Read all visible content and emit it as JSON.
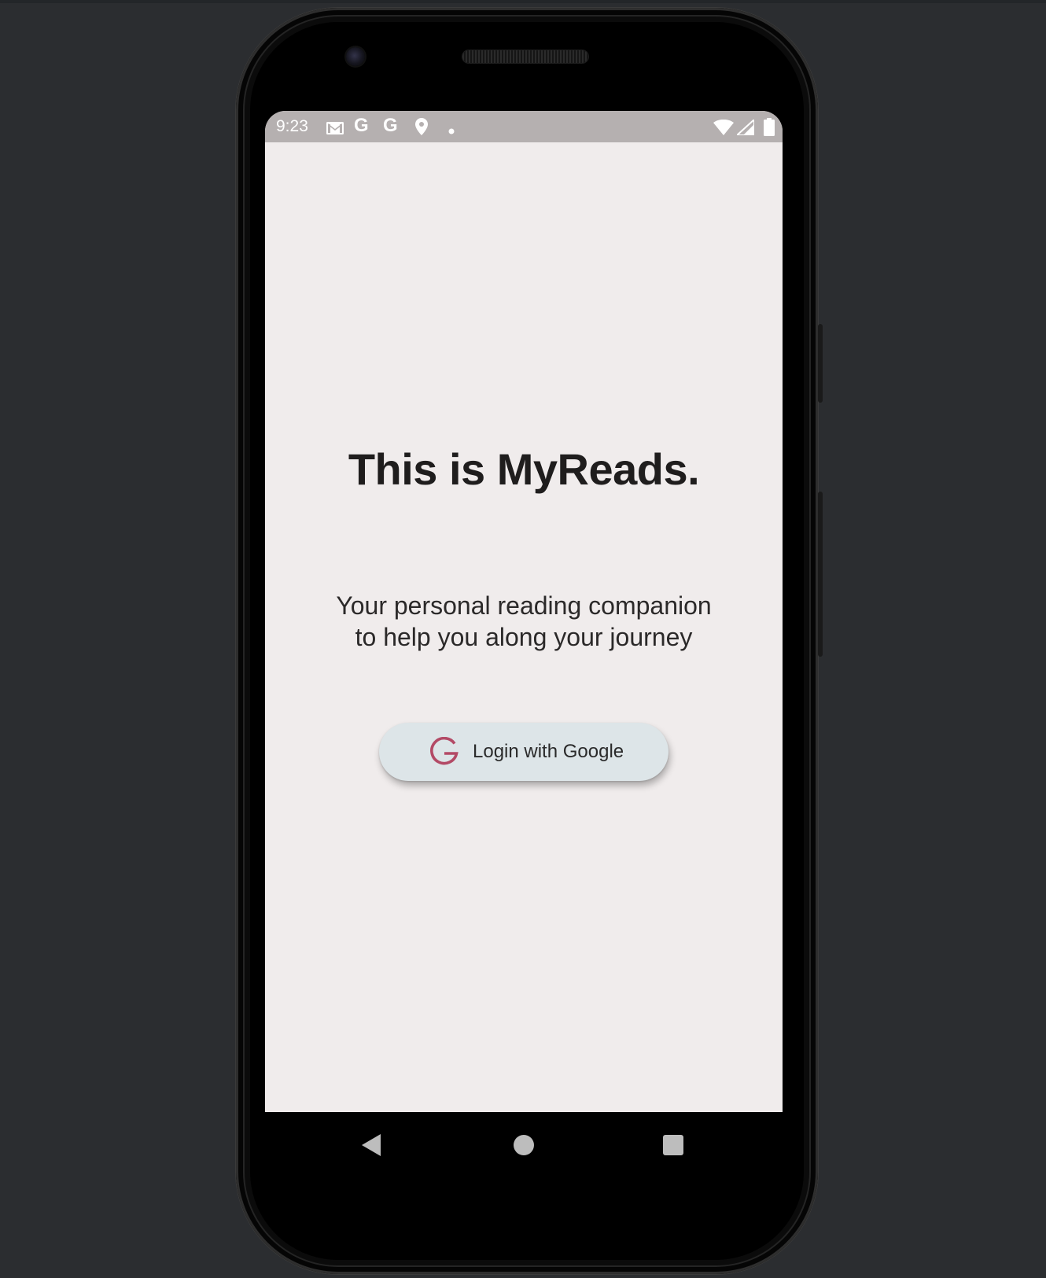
{
  "status_bar": {
    "time": "9:23",
    "notification_icons": [
      "gmail-icon",
      "google-icon",
      "google-icon",
      "location-icon",
      "dot-icon"
    ],
    "system_icons": [
      "wifi-icon",
      "signal-icon",
      "battery-icon"
    ],
    "google_glyph": "G"
  },
  "main": {
    "title": "This is MyReads.",
    "subtitle_line1": "Your personal reading companion",
    "subtitle_line2": "to help you along your journey",
    "login_button_label": "Login with Google",
    "login_icon": "google-g-icon"
  },
  "nav_bar": {
    "buttons": [
      "back-icon",
      "home-icon",
      "recents-icon"
    ]
  },
  "colors": {
    "screen_background": "#f0ecec",
    "status_bar_background": "#b5b0b0",
    "button_background": "#dde5e8",
    "google_g_accent": "#b34a66",
    "title_text": "#1f1d1d"
  }
}
